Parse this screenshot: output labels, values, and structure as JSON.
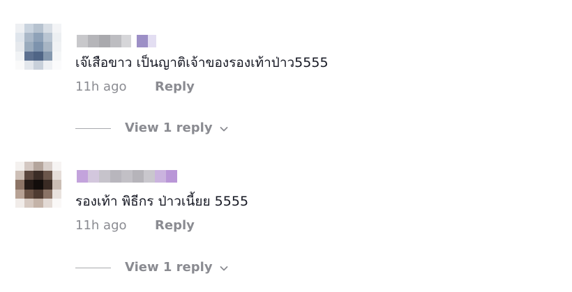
{
  "comments": [
    {
      "text": "เจ๊เสือขาว เป็นญาติเจ้าของรองเท้าป่าว5555",
      "time": "11h ago",
      "reply_label": "Reply",
      "view_replies_label": "View 1 reply"
    },
    {
      "text": "รองเท้า พิธีกร ป่าวเนี้ยย 5555",
      "time": "11h ago",
      "reply_label": "Reply",
      "view_replies_label": "View 1 reply"
    }
  ],
  "icons": {
    "chevron": "chevron-down-icon"
  },
  "colors": {
    "text": "#161823",
    "meta": "#8a8b91",
    "divider": "#a8a9ad"
  }
}
